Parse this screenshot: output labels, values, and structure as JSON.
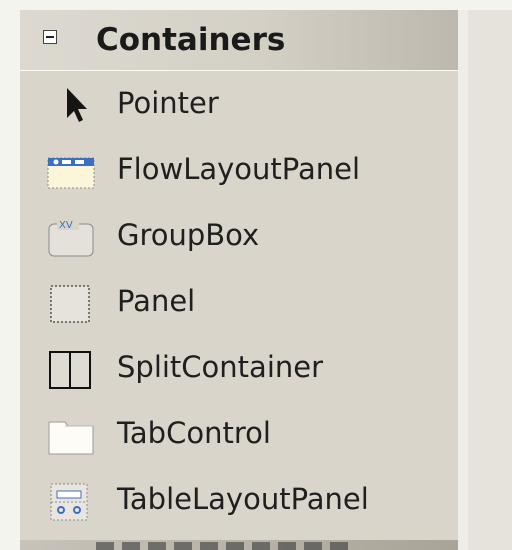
{
  "toolbox": {
    "group": {
      "title": "Containers",
      "expand_icon": "minus-box-icon"
    },
    "items": [
      {
        "label": "Pointer",
        "icon": "pointer-arrow-icon"
      },
      {
        "label": "FlowLayoutPanel",
        "icon": "flow-layout-panel-icon"
      },
      {
        "label": "GroupBox",
        "icon": "group-box-icon"
      },
      {
        "label": "Panel",
        "icon": "panel-icon"
      },
      {
        "label": "SplitContainer",
        "icon": "split-container-icon"
      },
      {
        "label": "TabControl",
        "icon": "tab-control-icon"
      },
      {
        "label": "TableLayoutPanel",
        "icon": "table-layout-panel-icon"
      }
    ]
  },
  "colors": {
    "background": "#d9d5cb",
    "header_gradient_end": "#bdb8ad",
    "icon_blue": "#3b6fc4"
  }
}
